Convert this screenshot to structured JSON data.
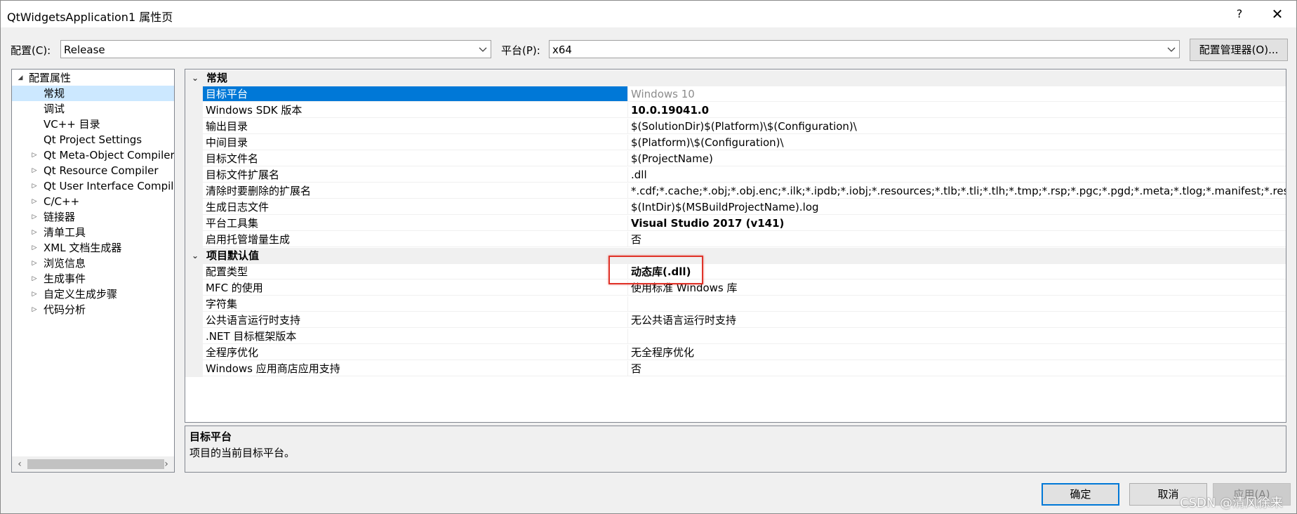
{
  "window": {
    "title": "QtWidgetsApplication1 属性页",
    "help_label": "?",
    "close_label": "✕"
  },
  "config": {
    "label": "配置(C):",
    "value": "Release"
  },
  "platform": {
    "label": "平台(P):",
    "value": "x64"
  },
  "manager_button": "配置管理器(O)...",
  "tree": {
    "items": [
      {
        "label": "配置属性",
        "expander": "◢"
      },
      {
        "label": "常规",
        "expander": ""
      },
      {
        "label": "调试",
        "expander": ""
      },
      {
        "label": "VC++ 目录",
        "expander": ""
      },
      {
        "label": "Qt Project Settings",
        "expander": ""
      },
      {
        "label": "Qt Meta-Object Compiler",
        "expander": "▷"
      },
      {
        "label": "Qt Resource Compiler",
        "expander": "▷"
      },
      {
        "label": "Qt User Interface Compiler",
        "expander": "▷"
      },
      {
        "label": "C/C++",
        "expander": "▷"
      },
      {
        "label": "链接器",
        "expander": "▷"
      },
      {
        "label": "清单工具",
        "expander": "▷"
      },
      {
        "label": "XML 文档生成器",
        "expander": "▷"
      },
      {
        "label": "浏览信息",
        "expander": "▷"
      },
      {
        "label": "生成事件",
        "expander": "▷"
      },
      {
        "label": "自定义生成步骤",
        "expander": "▷"
      },
      {
        "label": "代码分析",
        "expander": "▷"
      }
    ]
  },
  "grid": {
    "categories": [
      {
        "label": "常规",
        "rows": [
          {
            "name": "目标平台",
            "value": "Windows 10"
          },
          {
            "name": "Windows SDK 版本",
            "value": "10.0.19041.0"
          },
          {
            "name": "输出目录",
            "value": "$(SolutionDir)$(Platform)\\$(Configuration)\\"
          },
          {
            "name": "中间目录",
            "value": "$(Platform)\\$(Configuration)\\"
          },
          {
            "name": "目标文件名",
            "value": "$(ProjectName)"
          },
          {
            "name": "目标文件扩展名",
            "value": ".dll"
          },
          {
            "name": "清除时要删除的扩展名",
            "value": "*.cdf;*.cache;*.obj;*.obj.enc;*.ilk;*.ipdb;*.iobj;*.resources;*.tlb;*.tli;*.tlh;*.tmp;*.rsp;*.pgc;*.pgd;*.meta;*.tlog;*.manifest;*.res;*.pch;"
          },
          {
            "name": "生成日志文件",
            "value": "$(IntDir)$(MSBuildProjectName).log"
          },
          {
            "name": "平台工具集",
            "value": "Visual Studio 2017 (v141)"
          },
          {
            "name": "启用托管增量生成",
            "value": "否"
          }
        ]
      },
      {
        "label": "项目默认值",
        "rows": [
          {
            "name": "配置类型",
            "value": "动态库(.dll)"
          },
          {
            "name": "MFC 的使用",
            "value": "使用标准 Windows 库"
          },
          {
            "name": "字符集",
            "value": ""
          },
          {
            "name": "公共语言运行时支持",
            "value": "无公共语言运行时支持"
          },
          {
            "name": ".NET 目标框架版本",
            "value": ""
          },
          {
            "name": "全程序优化",
            "value": "无全程序优化"
          },
          {
            "name": "Windows 应用商店应用支持",
            "value": "否"
          }
        ]
      }
    ]
  },
  "description": {
    "title": "目标平台",
    "text": "项目的当前目标平台。"
  },
  "buttons": {
    "ok": "确定",
    "cancel": "取消",
    "apply": "应用(A)"
  },
  "watermark": "CSDN @清风徐来",
  "colors": {
    "selection": "#0078d7",
    "tree_selection": "#cce8ff",
    "highlight_box": "#e0342a"
  }
}
